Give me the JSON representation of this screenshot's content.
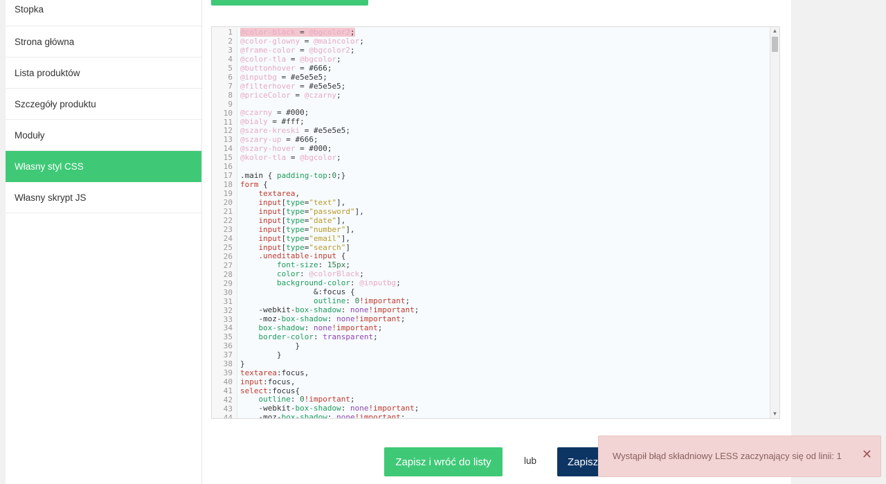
{
  "sidebar": {
    "items": [
      {
        "label": "Stopka",
        "active": false
      },
      {
        "label": "Strona główna",
        "active": false
      },
      {
        "label": "Lista produktów",
        "active": false
      },
      {
        "label": "Szczegóły produktu",
        "active": false
      },
      {
        "label": "Moduły",
        "active": false
      },
      {
        "label": "Własny styl CSS",
        "active": true
      },
      {
        "label": "Własny skrypt JS",
        "active": false
      }
    ]
  },
  "editor": {
    "lines": [
      [
        [
          "var",
          "@color-black"
        ],
        [
          "plain",
          " = "
        ],
        [
          "var",
          "@bgcolor2"
        ],
        [
          "plain",
          ";"
        ]
      ],
      [
        [
          "var",
          "@color-glowny"
        ],
        [
          "plain",
          " = "
        ],
        [
          "var",
          "@maincolor"
        ],
        [
          "plain",
          ";"
        ]
      ],
      [
        [
          "var",
          "@frame-color"
        ],
        [
          "plain",
          " = "
        ],
        [
          "var",
          "@bgcolor2"
        ],
        [
          "plain",
          ";"
        ]
      ],
      [
        [
          "var",
          "@color-tla"
        ],
        [
          "plain",
          " = "
        ],
        [
          "var",
          "@bgcolor"
        ],
        [
          "plain",
          ";"
        ]
      ],
      [
        [
          "var",
          "@buttonhover"
        ],
        [
          "plain",
          " = #666;"
        ]
      ],
      [
        [
          "var",
          "@inputbg"
        ],
        [
          "plain",
          " = #e5e5e5;"
        ]
      ],
      [
        [
          "var",
          "@filterhover"
        ],
        [
          "plain",
          " = #e5e5e5;"
        ]
      ],
      [
        [
          "var",
          "@priceColor"
        ],
        [
          "plain",
          " = "
        ],
        [
          "var",
          "@czarny"
        ],
        [
          "plain",
          ";"
        ]
      ],
      [],
      [
        [
          "var",
          "@czarny"
        ],
        [
          "plain",
          " = #000;"
        ]
      ],
      [
        [
          "var",
          "@bialy"
        ],
        [
          "plain",
          " = #fff;"
        ]
      ],
      [
        [
          "var",
          "@szare-kreski"
        ],
        [
          "plain",
          " = #e5e5e5;"
        ]
      ],
      [
        [
          "var",
          "@szary-up"
        ],
        [
          "plain",
          " = #666;"
        ]
      ],
      [
        [
          "var",
          "@szary-hover"
        ],
        [
          "plain",
          " = #000;"
        ]
      ],
      [
        [
          "var",
          "@kolor-tla"
        ],
        [
          "plain",
          " = "
        ],
        [
          "var",
          "@bgcolor"
        ],
        [
          "plain",
          ";"
        ]
      ],
      [],
      [
        [
          "plain",
          ".main { "
        ],
        [
          "prop",
          "padding-top"
        ],
        [
          "plain",
          ":"
        ],
        [
          "num",
          "0"
        ],
        [
          "plain",
          ";}"
        ]
      ],
      [
        [
          "kw",
          "form"
        ],
        [
          "plain",
          " {"
        ]
      ],
      [
        [
          "plain",
          "    "
        ],
        [
          "kw",
          "textarea"
        ],
        [
          "plain",
          ","
        ]
      ],
      [
        [
          "plain",
          "    "
        ],
        [
          "kw",
          "input"
        ],
        [
          "plain",
          "["
        ],
        [
          "prop",
          "type"
        ],
        [
          "plain",
          "="
        ],
        [
          "str",
          "\"text\""
        ],
        [
          "plain",
          "],"
        ]
      ],
      [
        [
          "plain",
          "    "
        ],
        [
          "kw",
          "input"
        ],
        [
          "plain",
          "["
        ],
        [
          "prop",
          "type"
        ],
        [
          "plain",
          "="
        ],
        [
          "str",
          "\"password\""
        ],
        [
          "plain",
          "],"
        ]
      ],
      [
        [
          "plain",
          "    "
        ],
        [
          "kw",
          "input"
        ],
        [
          "plain",
          "["
        ],
        [
          "prop",
          "type"
        ],
        [
          "plain",
          "="
        ],
        [
          "str",
          "\"date\""
        ],
        [
          "plain",
          "],"
        ]
      ],
      [
        [
          "plain",
          "    "
        ],
        [
          "kw",
          "input"
        ],
        [
          "plain",
          "["
        ],
        [
          "prop",
          "type"
        ],
        [
          "plain",
          "="
        ],
        [
          "str",
          "\"number\""
        ],
        [
          "plain",
          "],"
        ]
      ],
      [
        [
          "plain",
          "    "
        ],
        [
          "kw",
          "input"
        ],
        [
          "plain",
          "["
        ],
        [
          "prop",
          "type"
        ],
        [
          "plain",
          "="
        ],
        [
          "str",
          "\"email\""
        ],
        [
          "plain",
          "],"
        ]
      ],
      [
        [
          "plain",
          "    "
        ],
        [
          "kw",
          "input"
        ],
        [
          "plain",
          "["
        ],
        [
          "prop",
          "type"
        ],
        [
          "plain",
          "="
        ],
        [
          "str",
          "\"search\""
        ],
        [
          "plain",
          "]"
        ]
      ],
      [
        [
          "plain",
          "    "
        ],
        [
          "kw",
          ".uneditable-input"
        ],
        [
          "plain",
          " {"
        ]
      ],
      [
        [
          "plain",
          "        "
        ],
        [
          "prop",
          "font-size"
        ],
        [
          "plain",
          ": "
        ],
        [
          "num",
          "15px"
        ],
        [
          "plain",
          ";"
        ]
      ],
      [
        [
          "plain",
          "        "
        ],
        [
          "prop",
          "color"
        ],
        [
          "plain",
          ": "
        ],
        [
          "var",
          "@colorBlack"
        ],
        [
          "plain",
          ";"
        ]
      ],
      [
        [
          "plain",
          "        "
        ],
        [
          "prop",
          "background-color"
        ],
        [
          "plain",
          ": "
        ],
        [
          "var",
          "@inputbg"
        ],
        [
          "plain",
          ";"
        ]
      ],
      [
        [
          "plain",
          "                &:focus {"
        ]
      ],
      [
        [
          "plain",
          "                "
        ],
        [
          "prop",
          "outline"
        ],
        [
          "plain",
          ": "
        ],
        [
          "num",
          "0"
        ],
        [
          "kw",
          "!important"
        ],
        [
          "plain",
          ";"
        ]
      ],
      [
        [
          "plain",
          "    -webkit-"
        ],
        [
          "prop",
          "box-shadow"
        ],
        [
          "plain",
          ": "
        ],
        [
          "val",
          "none"
        ],
        [
          "kw",
          "!important"
        ],
        [
          "plain",
          ";"
        ]
      ],
      [
        [
          "plain",
          "    -moz-"
        ],
        [
          "prop",
          "box-shadow"
        ],
        [
          "plain",
          ": "
        ],
        [
          "val",
          "none"
        ],
        [
          "kw",
          "!important"
        ],
        [
          "plain",
          ";"
        ]
      ],
      [
        [
          "plain",
          "    "
        ],
        [
          "prop",
          "box-shadow"
        ],
        [
          "plain",
          ": "
        ],
        [
          "val",
          "none"
        ],
        [
          "kw",
          "!important"
        ],
        [
          "plain",
          ";"
        ]
      ],
      [
        [
          "plain",
          "    "
        ],
        [
          "prop",
          "border-color"
        ],
        [
          "plain",
          ": "
        ],
        [
          "val",
          "transparent"
        ],
        [
          "plain",
          ";"
        ]
      ],
      [
        [
          "plain",
          "            }"
        ]
      ],
      [
        [
          "plain",
          "        }"
        ]
      ],
      [
        [
          "plain",
          "}"
        ]
      ],
      [
        [
          "kw",
          "textarea"
        ],
        [
          "plain",
          ":focus,"
        ]
      ],
      [
        [
          "kw",
          "input"
        ],
        [
          "plain",
          ":focus,"
        ]
      ],
      [
        [
          "kw",
          "select"
        ],
        [
          "plain",
          ":focus{"
        ]
      ],
      [
        [
          "plain",
          "    "
        ],
        [
          "prop",
          "outline"
        ],
        [
          "plain",
          ": "
        ],
        [
          "num",
          "0"
        ],
        [
          "kw",
          "!important"
        ],
        [
          "plain",
          ";"
        ]
      ],
      [
        [
          "plain",
          "    -webkit-"
        ],
        [
          "prop",
          "box-shadow"
        ],
        [
          "plain",
          ": "
        ],
        [
          "val",
          "none"
        ],
        [
          "kw",
          "!important"
        ],
        [
          "plain",
          ";"
        ]
      ],
      [
        [
          "plain",
          "    -moz-"
        ],
        [
          "prop",
          "box-shadow"
        ],
        [
          "plain",
          ": "
        ],
        [
          "val",
          "none"
        ],
        [
          "kw",
          "!important"
        ],
        [
          "plain",
          ";"
        ]
      ]
    ]
  },
  "actions": {
    "save_back_label": "Zapisz i wróć do listy",
    "or_label": "lub",
    "save_label": "Zapisz"
  },
  "toast": {
    "message": "Wystąpił błąd składniowy LESS zaczynający się od linii: 1",
    "close_glyph": "✕"
  },
  "scroll": {
    "up_glyph": "▲",
    "down_glyph": "▼"
  },
  "colors": {
    "accent": "#3fc977",
    "navy": "#0d3563",
    "error_bg": "#f2d4d4"
  }
}
